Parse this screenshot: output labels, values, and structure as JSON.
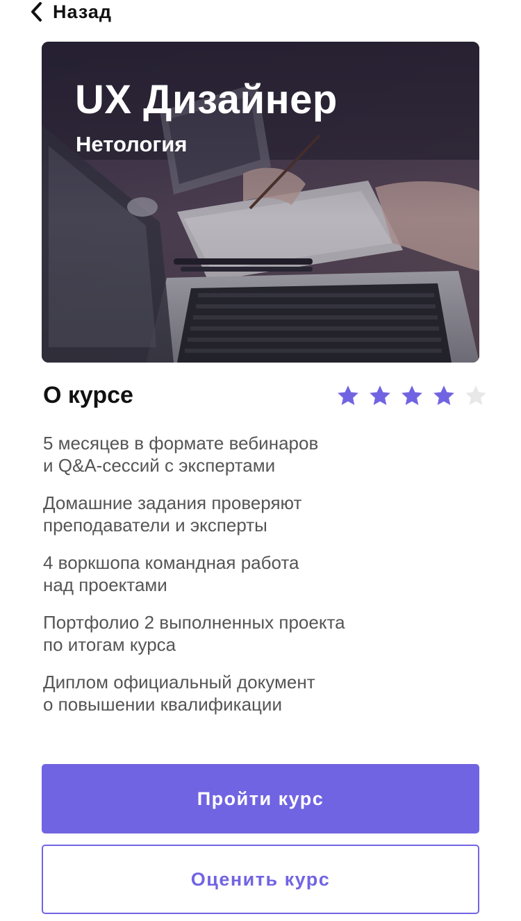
{
  "nav": {
    "back_label": "Назад",
    "back_icon": "chevron-left-icon"
  },
  "course": {
    "title": "UX Дизайнер",
    "provider": "Нетология"
  },
  "about": {
    "heading": "О курсе",
    "rating": {
      "value": 4,
      "max": 5
    },
    "features": [
      {
        "line1": "5 месяцев в формате вебинаров",
        "line2": "и Q&A-сессий с экспертами"
      },
      {
        "line1": "Домашние задания проверяют",
        "line2": "преподаватели и эксперты"
      },
      {
        "line1": "4 воркшопа командная работа",
        "line2": "над проектами"
      },
      {
        "line1": "Портфолио 2 выполненных проекта",
        "line2": "по итогам курса"
      },
      {
        "line1": "Диплом официальный документ",
        "line2": "о повышении квалификации"
      }
    ]
  },
  "actions": {
    "primary_label": "Пройти курс",
    "secondary_label": "Оценить курс"
  },
  "colors": {
    "accent": "#7164e2",
    "star_filled": "#7164e2",
    "star_empty": "#e8e8e8",
    "text_secondary": "#555555"
  }
}
